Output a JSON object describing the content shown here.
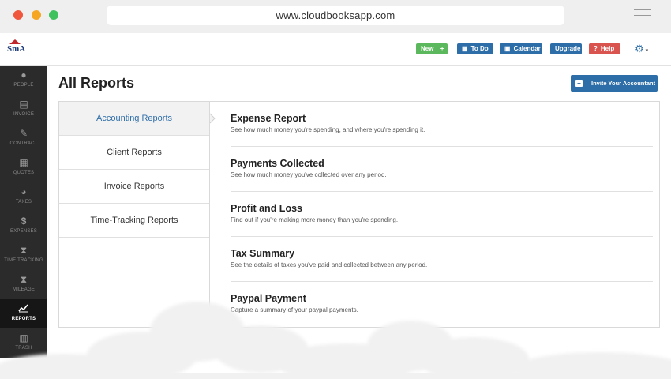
{
  "browser": {
    "url": "www.cloudbooksapp.com"
  },
  "header": {
    "logo_text": "SmA",
    "buttons": {
      "new": "New",
      "todo": "To Do",
      "calendar": "Calendar",
      "upgrade": "Upgrade",
      "help": "Help"
    }
  },
  "sidebar": {
    "items": [
      {
        "label": "PEOPLE",
        "icon": "person-icon"
      },
      {
        "label": "INVOICE",
        "icon": "document-icon"
      },
      {
        "label": "CONTRACT",
        "icon": "pen-icon"
      },
      {
        "label": "QUOTES",
        "icon": "calculator-icon"
      },
      {
        "label": "TAXES",
        "icon": "pie-chart-icon"
      },
      {
        "label": "EXPENSES",
        "icon": "dollar-icon"
      },
      {
        "label": "TIME TRACKING",
        "icon": "hourglass-icon"
      },
      {
        "label": "MILEAGE",
        "icon": "hourglass-icon"
      },
      {
        "label": "REPORTS",
        "icon": "line-chart-icon",
        "active": true
      },
      {
        "label": "TRASH",
        "icon": "trash-icon"
      }
    ]
  },
  "main": {
    "title": "All Reports",
    "invite_label": "Invite Your Accountant",
    "categories": [
      {
        "label": "Accounting Reports",
        "active": true
      },
      {
        "label": "Client Reports"
      },
      {
        "label": "Invoice Reports"
      },
      {
        "label": "Time-Tracking Reports"
      }
    ],
    "reports": [
      {
        "title": "Expense Report",
        "desc": "See how much money you're spending, and where you're spending it."
      },
      {
        "title": "Payments Collected",
        "desc": "See how much money you've collected over any period."
      },
      {
        "title": "Profit and Loss",
        "desc": "Find out if you're making more money than you're spending."
      },
      {
        "title": "Tax Summary",
        "desc": "See the details of taxes you've paid and collected between any period."
      },
      {
        "title": "Paypal Payment",
        "desc": "Capture a summary of your paypal payments."
      }
    ]
  },
  "colors": {
    "accent": "#2e6ea8",
    "new_button": "#5cb85c",
    "help_button": "#d9534f",
    "sidebar_bg": "#2b2b2b"
  }
}
